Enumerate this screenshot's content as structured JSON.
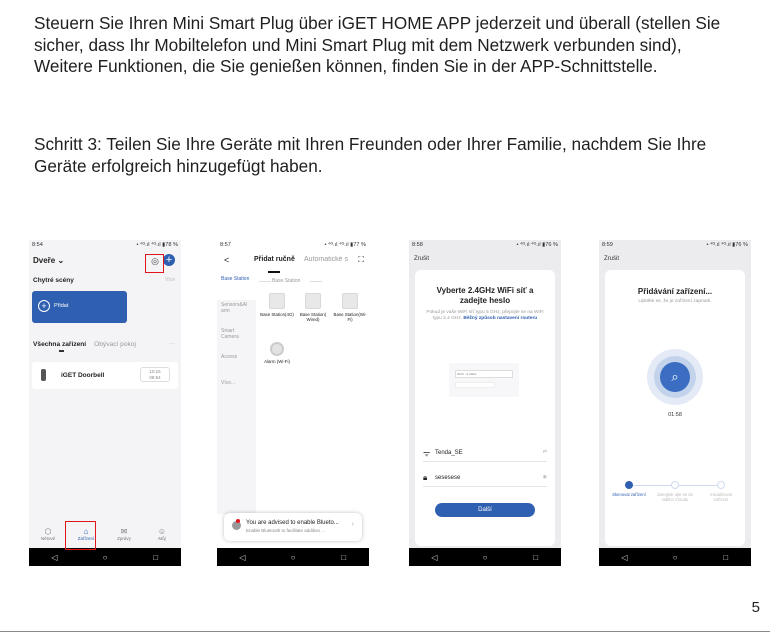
{
  "intro_text": "Steuern Sie Ihren Mini Smart Plug über iGET HOME APP jederzeit und überall (stellen Sie sicher, dass Ihr Mobiltelefon und Mini Smart Plug mit dem Netzwerk verbunden sind), Weitere Funktionen, die Sie genießen können, finden Sie in der APP-Schnittstelle.",
  "step_text": "Schritt 3: Teilen Sie Ihre Geräte mit Ihren Freunden oder Ihrer Familie, nachdem Sie Ihre Geräte erfolgreich hinzugefügt haben.",
  "page_number": "5",
  "annotation_color": "#e0161c",
  "accent_color": "#2f5fb0",
  "screen1": {
    "time": "8:54",
    "status_right": "• ⁴ᴳ.ıl ⁴ᴳ.ıl ▮78 %",
    "home_title": "Dveře ⌄",
    "scenes_heading": "Chytré scény",
    "scenes_more": "Více",
    "add_label": "Přidat",
    "tab_all": "Všechna zařízení",
    "tab_living": "Obývací pokoj",
    "tab_more": "···",
    "device_name": "iGET Doorbell",
    "device_time": "10:15\n08:54",
    "bottom_tabs": [
      {
        "icon": "⬡",
        "label": "Nétové"
      },
      {
        "icon": "⌂",
        "label": "Zařízení"
      },
      {
        "icon": "✉",
        "label": "Zprávy"
      },
      {
        "icon": "☺",
        "label": "Můj"
      }
    ]
  },
  "screen2": {
    "time": "8:57",
    "status_right": "• ⁴ᴳ.ıl ⁴ᴳ.ıl ▮77 %",
    "back": "<",
    "tab_manual": "Přidat ručně",
    "tab_auto": "Automatické s",
    "sidebar": [
      "Base Station",
      "Sensors&Al arm",
      "Smart Camera",
      "Access",
      "Více..."
    ],
    "section_title": "Base Station",
    "devices": [
      "Base Station(4G)",
      "Base Station( Wired)",
      "Base Station(Wi-Fi)",
      "Alarm (Wi-Fi)"
    ],
    "toast_title": "You are advised to enable Blueto...",
    "toast_sub": "Enable Bluetooth to facilitate addition ..."
  },
  "screen3": {
    "time": "8:58",
    "status_right": "• ⁴ᴳ.ıl ⁴ᴳ.ıl ▮76 %",
    "cancel": "Zrušit",
    "heading": "Vyberte 2.4GHz WiFi síť a zadejte heslo",
    "sub_text": "Pokud je vaše WiFi síť typu 5 GHz, přepojte se na WiFi typu 2.4 GHz. ",
    "sub_link": "Běžný způsob nastavení routeru",
    "illu_row": "Wi-Fi - 2.4Ghz",
    "wifi_name": "Tenda_SE",
    "wifi_action": "⇄",
    "password": "sesesese",
    "next_button": "Další"
  },
  "screen4": {
    "time": "8:59",
    "status_right": "• ⁴ᴳ.ıl ⁴ᴳ.ıl ▮76 %",
    "cancel": "Zrušit",
    "heading": "Přidávání zařízení...",
    "sub_text": "Ujistěte se, že je zařízení zapnuté.",
    "timer": "01:58",
    "steps": [
      "Skenovat zařízení",
      "Zaregistr ujte se do vidtiho Cloudu",
      "Inicializovat zařízení"
    ]
  },
  "navbar": {
    "back": "◁",
    "home": "○",
    "recent": "□"
  }
}
